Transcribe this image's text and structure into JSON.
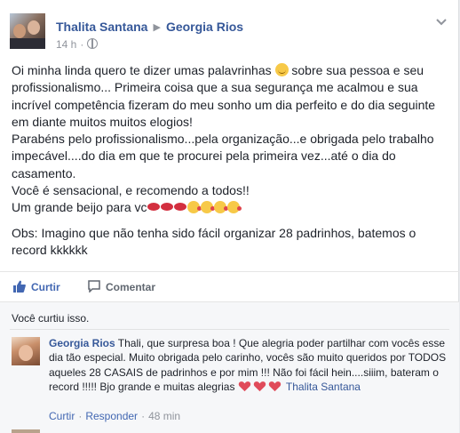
{
  "post": {
    "author": "Thalita Santana",
    "recipient": "Georgia Rios",
    "time": "14 h",
    "paragraphs": [
      {
        "before": "Oi minha linda quero te dizer umas palavrinhas ",
        "after": " sobre sua pessoa e seu profissionalismo... Primeira coisa que a sua segurança me acalmou e sua incrível competência fizeram do meu sonho um dia perfeito e do dia seguinte em diante muitos muitos elogios!"
      },
      {
        "text": "Parabéns pelo profissionalismo...pela organização...e obrigada pelo trabalho impecável....do dia em que te procurei pela primeira vez...até o dia do casamento."
      },
      {
        "text": "Você é sensacional, e recomendo a todos!!"
      },
      {
        "text": "Um grande beijo para vc"
      }
    ],
    "obs": "Obs: Imagino que não tenha sido fácil organizar 28 padrinhos, batemos o record kkkkkk",
    "emojis": [
      "smile-emoji",
      "lips-emoji",
      "kiss-emoji"
    ]
  },
  "actions": {
    "like_label": "Curtir",
    "comment_label": "Comentar",
    "accent": "#4267b2"
  },
  "reactions": {
    "liked_text": "Você curtiu isso."
  },
  "comment": {
    "author": "Georgia Rios",
    "text": " Thali, que surpresa boa ! Que alegria poder partilhar com vocês esse dia tão especial. Muito obrigada pelo carinho, vocês são muito queridos por TODOS aqueles 28 CASAIS de padrinhos e por mim !!! Não foi fácil hein....siiim, bateram o record !!!!! Bjo grande e muitas alegrias ",
    "tag": "Thalita Santana",
    "like_label": "Curtir",
    "reply_label": "Responder",
    "time": "48 min",
    "heart_color": "#e04b5a"
  }
}
